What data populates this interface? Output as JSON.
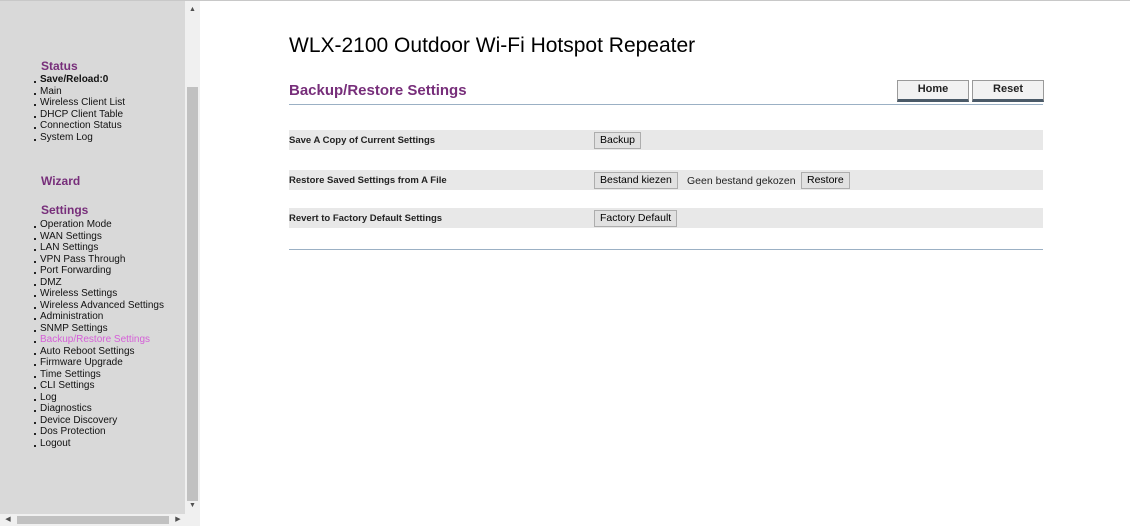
{
  "app": {
    "title": "WLX-2100 Outdoor Wi-Fi Hotspot Repeater"
  },
  "sidebar": {
    "status": {
      "title": "Status",
      "items": [
        "Save/Reload:0",
        "Main",
        "Wireless Client List",
        "DHCP Client Table",
        "Connection Status",
        "System Log"
      ]
    },
    "wizard": {
      "title": "Wizard"
    },
    "settings": {
      "title": "Settings",
      "items": [
        "Operation Mode",
        "WAN Settings",
        "LAN Settings",
        "VPN Pass Through",
        "Port Forwarding",
        "DMZ",
        "Wireless Settings",
        "Wireless Advanced Settings",
        "Administration",
        "SNMP Settings",
        "Backup/Restore Settings",
        "Auto Reboot Settings",
        "Firmware Upgrade",
        "Time Settings",
        "CLI Settings",
        "Log",
        "Diagnostics",
        "Device Discovery",
        "Dos Protection",
        "Logout"
      ],
      "active": "Backup/Restore Settings"
    }
  },
  "main": {
    "section_title": "Backup/Restore Settings",
    "home_label": "Home",
    "reset_label": "Reset",
    "rows": [
      {
        "label": "Save A Copy of Current Settings",
        "button": "Backup"
      },
      {
        "label": "Restore Saved Settings from A File",
        "file_button": "Bestand kiezen",
        "file_status": "Geen bestand gekozen",
        "button": "Restore"
      },
      {
        "label": "Revert to Factory Default Settings",
        "button": "Factory Default"
      }
    ]
  },
  "colors": {
    "accent": "#772e7a",
    "active_link": "#d55fd8",
    "sidebar_bg": "#d9d9d9",
    "row_bg": "#e8e8e8"
  }
}
